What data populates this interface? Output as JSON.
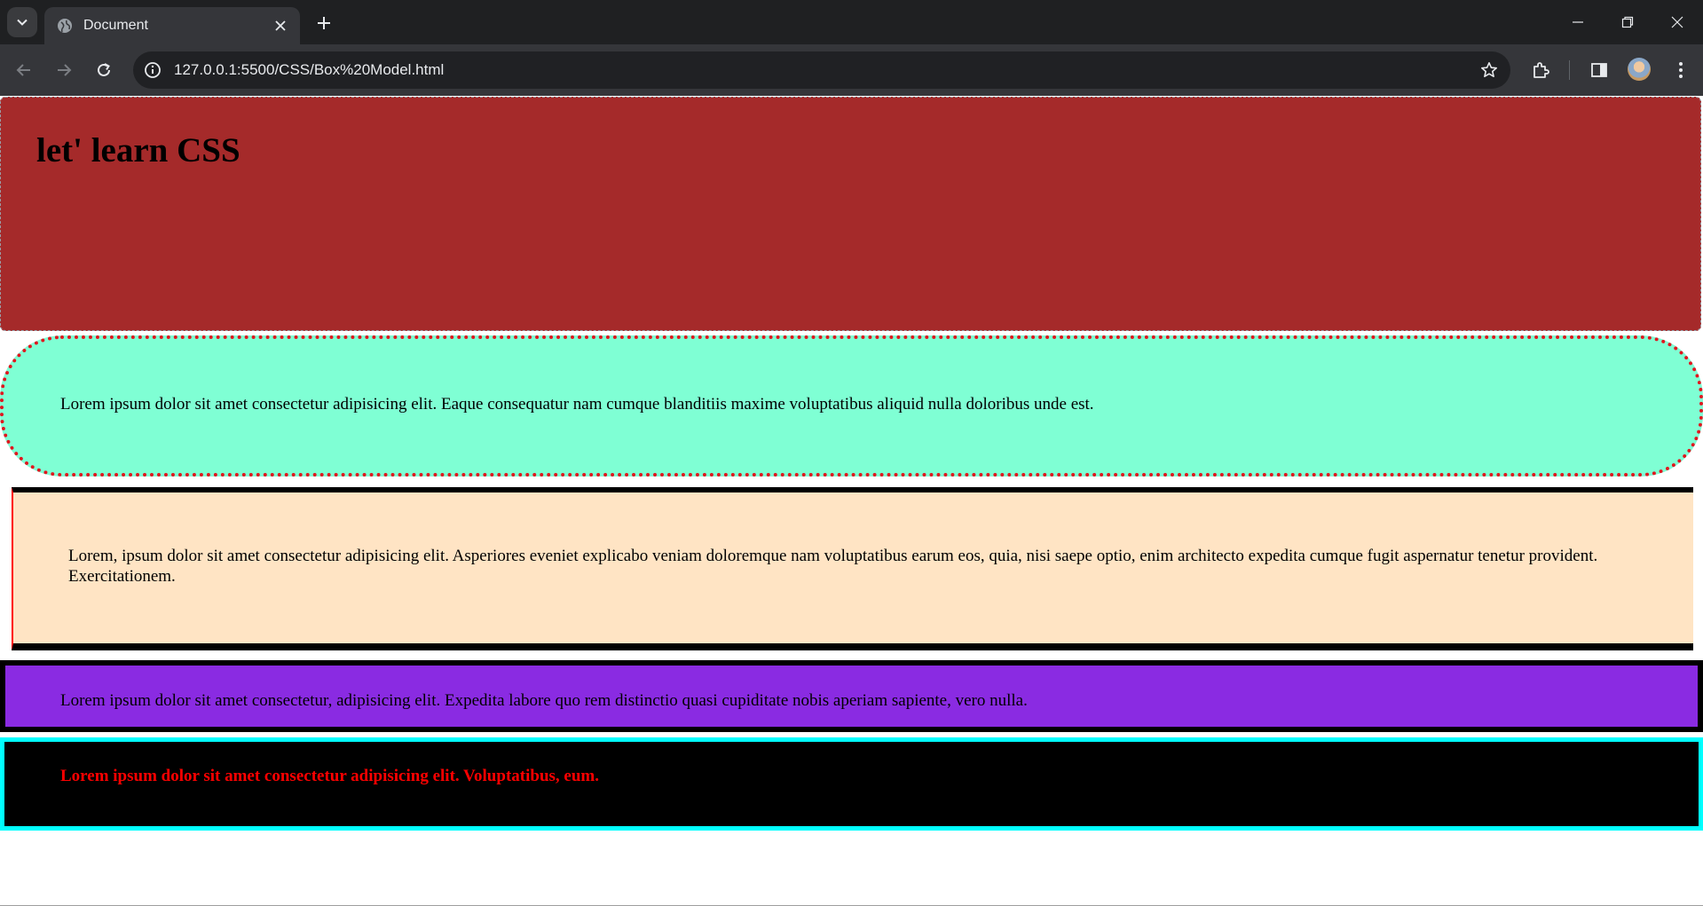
{
  "browser": {
    "tab_title": "Document",
    "url": "127.0.0.1:5500/CSS/Box%20Model.html",
    "icons": {
      "tab_search": "chevron-down-icon",
      "favicon": "globe-icon",
      "tab_close": "close-icon",
      "new_tab": "plus-icon",
      "minimize": "minimize-icon",
      "restore": "restore-icon",
      "window_close": "close-icon",
      "back": "arrow-left-icon",
      "forward": "arrow-right-icon",
      "reload": "reload-icon",
      "site_info": "info-icon",
      "bookmark": "star-icon",
      "extensions": "puzzle-icon",
      "side_panel": "side-panel-icon",
      "profile": "avatar",
      "menu": "kebab-menu-icon"
    }
  },
  "page": {
    "heading": "let' learn CSS",
    "para_aqua": "Lorem ipsum dolor sit amet consectetur adipisicing elit. Eaque consequatur nam cumque blanditiis maxime voluptatibus aliquid nulla doloribus unde est.",
    "para_bisque": "Lorem, ipsum dolor sit amet consectetur adipisicing elit. Asperiores eveniet explicabo veniam doloremque nam voluptatibus earum eos, quia, nisi saepe optio, enim architecto expedita cumque fugit aspernatur tenetur provident. Exercitationem.",
    "para_violet": "Lorem ipsum dolor sit amet consectetur, adipisicing elit. Expedita labore quo rem distinctio quasi cupiditate nobis aperiam sapiente, vero nulla.",
    "para_black": "Lorem ipsum dolor sit amet consectetur adipisicing elit. Voluptatibus, eum."
  },
  "colors": {
    "box1_bg": "#a52a2a",
    "box2_bg": "#7fffd4",
    "box2_border": "#e0161e",
    "box3_bg": "#ffe4c4",
    "box4_bg": "#8a2be2",
    "box5_bg": "#000000",
    "box5_border": "#00ffff",
    "box5_text": "#ff0000"
  }
}
